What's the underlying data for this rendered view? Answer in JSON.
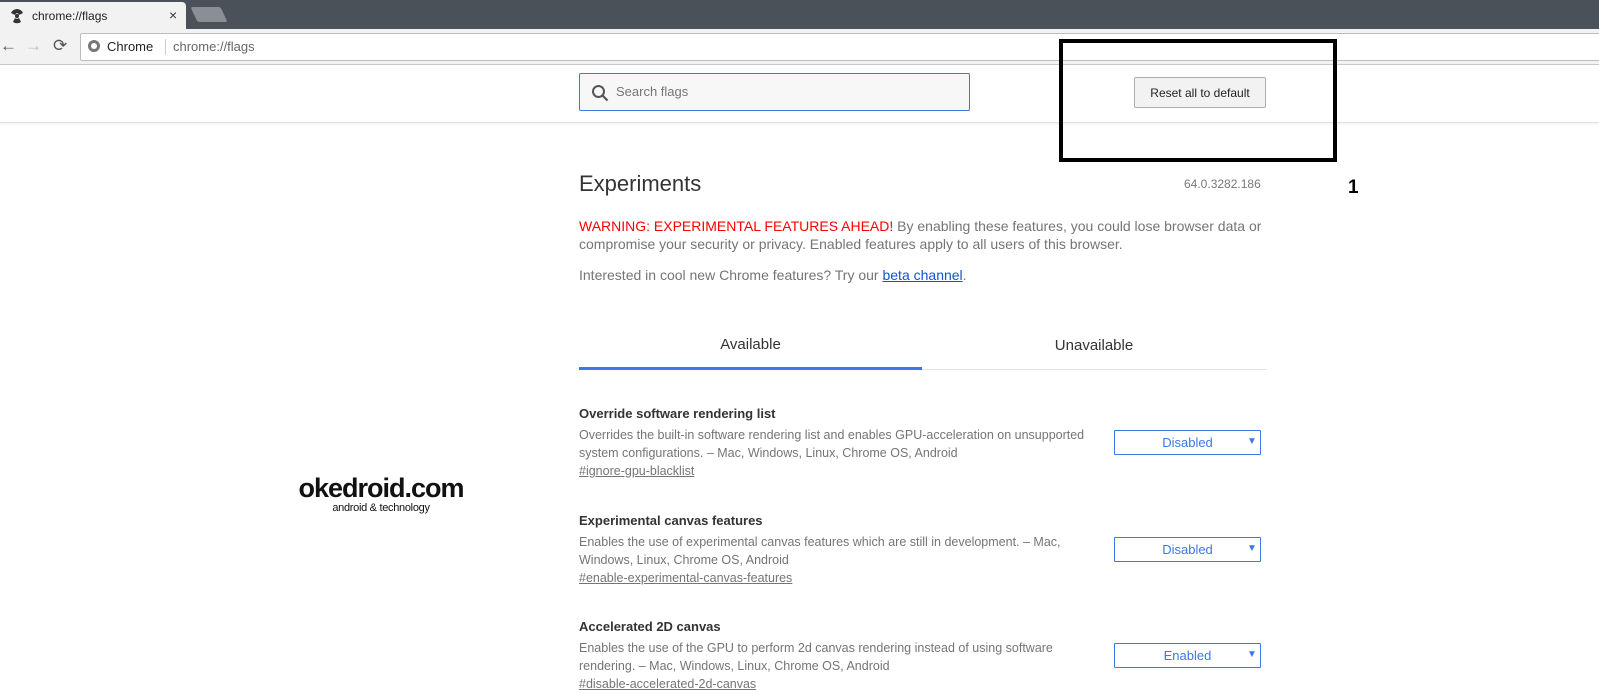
{
  "browser": {
    "tab_title": "chrome://flags",
    "tab_close": "×",
    "nav": {
      "back": "←",
      "forward": "→",
      "reload": "⟳"
    },
    "omnibox_label": "Chrome",
    "omnibox_url": "chrome://flags"
  },
  "header": {
    "search_placeholder": "Search flags",
    "reset_label": "Reset all to default"
  },
  "annotation": {
    "number": "1"
  },
  "main": {
    "title": "Experiments",
    "version": "64.0.3282.186",
    "warning_red": "WARNING: EXPERIMENTAL FEATURES AHEAD!",
    "warning_rest": " By enabling these features, you could lose browser data or compromise your security or privacy. Enabled features apply to all users of this browser.",
    "beta_prefix": "Interested in cool new Chrome features? Try our ",
    "beta_link": "beta channel",
    "beta_suffix": ".",
    "tabs": [
      {
        "label": "Available",
        "active": true
      },
      {
        "label": "Unavailable",
        "active": false
      }
    ],
    "flags": [
      {
        "name": "Override software rendering list",
        "description": "Overrides the built-in software rendering list and enables GPU-acceleration on unsupported system configurations. – Mac, Windows, Linux, Chrome OS, Android",
        "hash": "#ignore-gpu-blacklist",
        "value": "Disabled"
      },
      {
        "name": "Experimental canvas features",
        "description": "Enables the use of experimental canvas features which are still in development. – Mac, Windows, Linux, Chrome OS, Android",
        "hash": "#enable-experimental-canvas-features",
        "value": "Disabled"
      },
      {
        "name": "Accelerated 2D canvas",
        "description": "Enables the use of the GPU to perform 2d canvas rendering instead of using software rendering. – Mac, Windows, Linux, Chrome OS, Android",
        "hash": "#disable-accelerated-2d-canvas",
        "value": "Enabled"
      }
    ]
  },
  "watermark": {
    "brand": "okedroid.com",
    "tagline": "android & technology"
  },
  "colors": {
    "accent": "#3b78e7",
    "warning": "#ff0000",
    "link": "#1155cc",
    "tabstrip": "#4b5159"
  }
}
